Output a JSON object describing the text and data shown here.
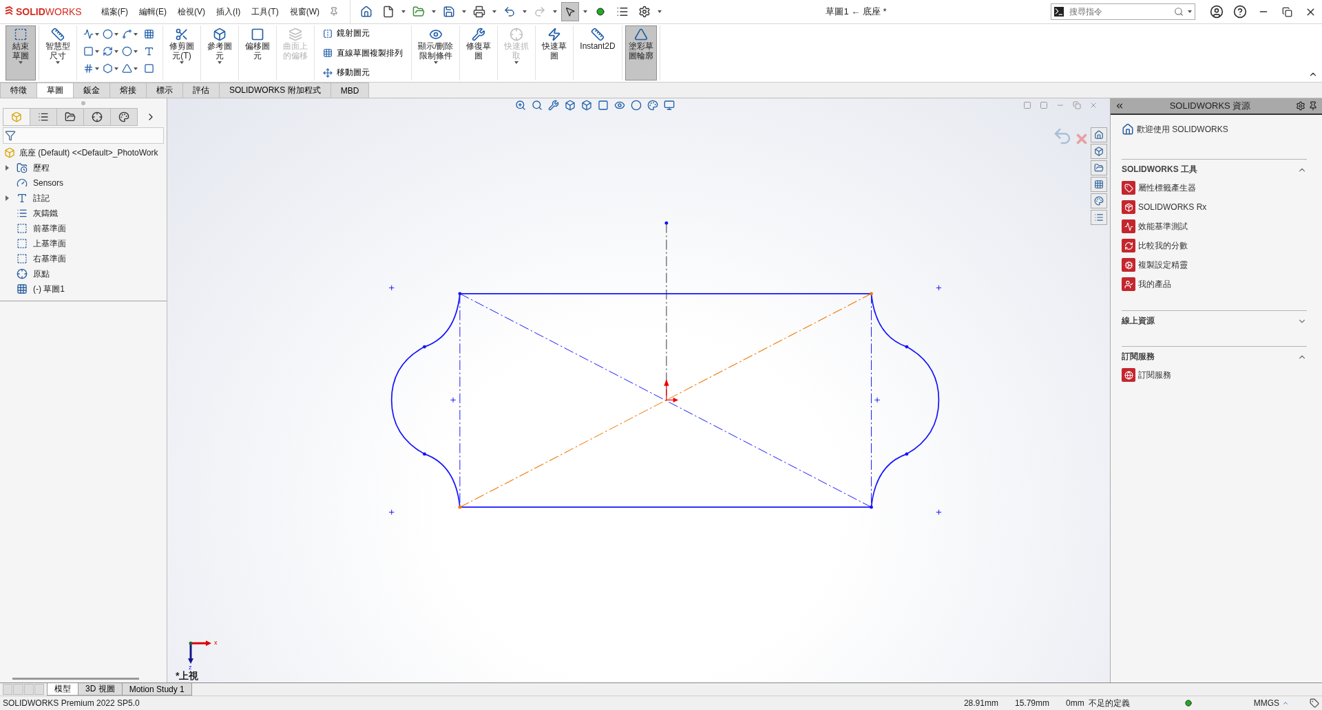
{
  "app": {
    "logo": "**SOLID**WORKS",
    "menus": [
      "檔案(F)",
      "編輯(E)",
      "檢視(V)",
      "插入(I)",
      "工具(T)",
      "視窗(W)"
    ],
    "title": "草圖1 ← 底座 *",
    "search": {
      "placeholder": "搜尋指令"
    }
  },
  "ribbon": {
    "tools": [
      {
        "kind": "large",
        "lines": [
          "結束",
          "草圖"
        ],
        "selected": true,
        "disabled": false,
        "dropdown": true
      },
      {
        "kind": "large",
        "lines": [
          "智慧型",
          "尺寸"
        ],
        "selected": false,
        "disabled": false,
        "dropdown": true
      },
      {
        "kind": "grid"
      },
      {
        "kind": "large",
        "lines": [
          "修剪圖",
          "元(T)"
        ],
        "selected": false,
        "disabled": false,
        "dropdown": true
      },
      {
        "kind": "large",
        "lines": [
          "參考圖",
          "元"
        ],
        "selected": false,
        "disabled": false,
        "dropdown": true
      },
      {
        "kind": "large",
        "lines": [
          "偏移圖",
          "元"
        ],
        "selected": false,
        "disabled": false,
        "dropdown": false
      },
      {
        "kind": "large",
        "lines": [
          "曲面上",
          "的偏移"
        ],
        "selected": false,
        "disabled": true,
        "dropdown": false
      },
      {
        "kind": "list",
        "items": [
          "鏡射圖元",
          "直線草圖複製排列",
          "移動圖元"
        ]
      },
      {
        "kind": "large",
        "lines": [
          "顯示/刪除",
          "限制條件"
        ],
        "selected": false,
        "disabled": false,
        "dropdown": true
      },
      {
        "kind": "large",
        "lines": [
          "修復草",
          "圖"
        ],
        "selected": false,
        "disabled": false,
        "dropdown": false
      },
      {
        "kind": "large",
        "lines": [
          "快速抓",
          "取"
        ],
        "selected": false,
        "disabled": true,
        "dropdown": true
      },
      {
        "kind": "large",
        "lines": [
          "快速草",
          "圖"
        ],
        "selected": false,
        "disabled": false,
        "dropdown": false
      },
      {
        "kind": "large",
        "lines": [
          "Instant2D"
        ],
        "selected": false,
        "disabled": false,
        "dropdown": false
      },
      {
        "kind": "large",
        "lines": [
          "塗彩草",
          "圖輪廓"
        ],
        "selected": true,
        "disabled": false,
        "dropdown": false
      }
    ],
    "tabs": [
      {
        "label": "特徵",
        "selected": false
      },
      {
        "label": "草圖",
        "selected": true
      },
      {
        "label": "鈑金",
        "selected": false
      },
      {
        "label": "熔接",
        "selected": false
      },
      {
        "label": "標示",
        "selected": false
      },
      {
        "label": "評估",
        "selected": false
      },
      {
        "label": "SOLIDWORKS 附加程式",
        "selected": false
      },
      {
        "label": "MBD",
        "selected": false
      }
    ]
  },
  "tree": {
    "panel_tabs": [
      {
        "selected": true
      },
      {
        "selected": false
      },
      {
        "selected": false
      },
      {
        "selected": false
      },
      {
        "selected": false
      }
    ],
    "root": "底座 (Default) <<Default>_PhotoWork",
    "items": [
      {
        "label": "歷程",
        "expandable": true
      },
      {
        "label": "Sensors",
        "expandable": false
      },
      {
        "label": "註記",
        "expandable": true
      },
      {
        "label": "灰鑄鐵",
        "expandable": false
      },
      {
        "label": "前基準面",
        "expandable": false
      },
      {
        "label": "上基準面",
        "expandable": false
      },
      {
        "label": "右基準面",
        "expandable": false
      },
      {
        "label": "原點",
        "expandable": false
      },
      {
        "label": "(-) 草圖1",
        "expandable": false
      }
    ]
  },
  "viewport": {
    "view_name": "*上視",
    "triad": {
      "x_label": "x",
      "z_label": "z"
    }
  },
  "resources": {
    "title": "SOLIDWORKS 資源",
    "welcome": "歡迎使用 SOLIDWORKS",
    "sections": [
      {
        "title": "SOLIDWORKS 工具",
        "expanded": true,
        "items": [
          "屬性標籤產生器",
          "SOLIDWORKS Rx",
          "效能基準測試",
          "比較我的分數",
          "複製設定精靈",
          "我的產品"
        ]
      },
      {
        "title": "線上資源",
        "expanded": false
      },
      {
        "title": "訂閱服務",
        "expanded": true,
        "items": [
          "訂閱服務"
        ]
      }
    ]
  },
  "bottom_tabs": [
    {
      "label": "模型",
      "selected": true
    },
    {
      "label": "3D 視圖",
      "selected": false
    },
    {
      "label": "Motion Study 1",
      "selected": false
    }
  ],
  "status_bar": {
    "product": "SOLIDWORKS Premium 2022 SP5.0",
    "x": "28.91mm",
    "y": "15.79mm",
    "z": "0mm",
    "state": "不足的定義",
    "units": "MMGS"
  }
}
